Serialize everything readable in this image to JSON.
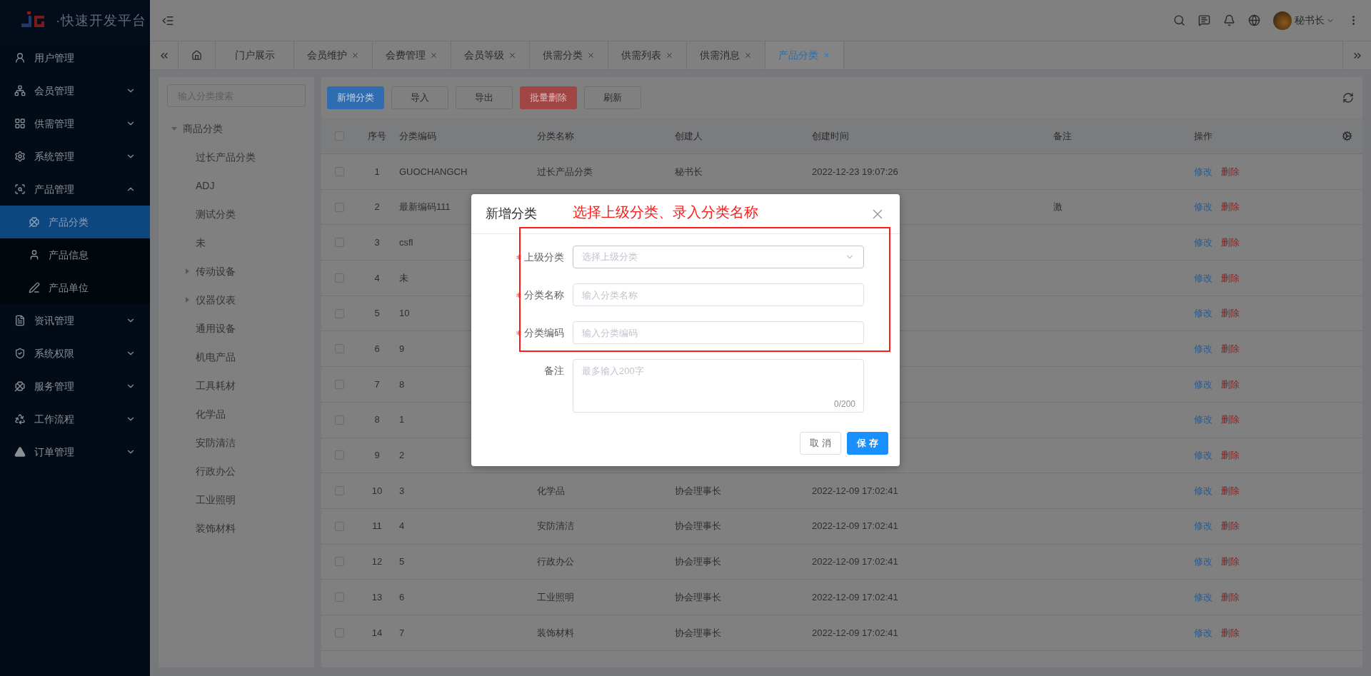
{
  "logo": {
    "text": "·快速开发平台"
  },
  "sidebar": {
    "items": [
      {
        "label": "用户管理",
        "kind": "link",
        "selected": false
      },
      {
        "label": "会员管理",
        "kind": "group",
        "expanded": false,
        "selected": false
      },
      {
        "label": "供需管理",
        "kind": "group",
        "expanded": false,
        "selected": false
      },
      {
        "label": "系统管理",
        "kind": "group",
        "expanded": false,
        "selected": false
      },
      {
        "label": "产品管理",
        "kind": "group",
        "expanded": true,
        "selected": false,
        "children": [
          {
            "label": "产品分类",
            "selected": true
          },
          {
            "label": "产品信息",
            "selected": false
          },
          {
            "label": "产品单位",
            "selected": false
          }
        ]
      },
      {
        "label": "资讯管理",
        "kind": "group",
        "expanded": false,
        "selected": false
      },
      {
        "label": "系统权限",
        "kind": "group",
        "expanded": false,
        "selected": false
      },
      {
        "label": "服务管理",
        "kind": "group",
        "expanded": false,
        "selected": false
      },
      {
        "label": "工作流程",
        "kind": "group",
        "expanded": false,
        "selected": false
      },
      {
        "label": "订单管理",
        "kind": "group",
        "expanded": false,
        "selected": false
      }
    ]
  },
  "header": {
    "user": {
      "name": "秘书长"
    }
  },
  "tabs": [
    {
      "kind": "home",
      "closable": false,
      "selected": false
    },
    {
      "label": "门户展示",
      "closable": false,
      "selected": false
    },
    {
      "label": "会员维护",
      "closable": true,
      "selected": false
    },
    {
      "label": "会费管理",
      "closable": true,
      "selected": false
    },
    {
      "label": "会员等级",
      "closable": true,
      "selected": false
    },
    {
      "label": "供需分类",
      "closable": true,
      "selected": false
    },
    {
      "label": "供需列表",
      "closable": true,
      "selected": false
    },
    {
      "label": "供需消息",
      "closable": true,
      "selected": false
    },
    {
      "label": "产品分类",
      "closable": true,
      "selected": true
    }
  ],
  "tree": {
    "search": {
      "placeholder": "输入分类搜索"
    },
    "root": {
      "label": "商品分类",
      "expanded": true,
      "children": [
        {
          "label": "过长产品分类"
        },
        {
          "label": "ADJ"
        },
        {
          "label": "测试分类"
        },
        {
          "label": "未"
        },
        {
          "label": "传动设备",
          "expanded": false
        },
        {
          "label": "仪器仪表",
          "expanded": false
        },
        {
          "label": "通用设备"
        },
        {
          "label": "机电产品"
        },
        {
          "label": "工具耗材"
        },
        {
          "label": "化学品"
        },
        {
          "label": "安防清洁"
        },
        {
          "label": "行政办公"
        },
        {
          "label": "工业照明"
        },
        {
          "label": "装饰材料"
        }
      ]
    }
  },
  "toolbar": {
    "buttons": [
      {
        "label": "新增分类",
        "kind": "primary"
      },
      {
        "label": "导入",
        "kind": "default"
      },
      {
        "label": "导出",
        "kind": "default"
      },
      {
        "label": "批量删除",
        "kind": "danger"
      },
      {
        "label": "刷新",
        "kind": "default"
      }
    ]
  },
  "table": {
    "header_checked": false,
    "columns": [
      "序号",
      "分类编码",
      "分类名称",
      "创建人",
      "创建时间",
      "备注",
      "操作"
    ],
    "rows": [
      {
        "checked": false,
        "index": "1",
        "code": "GUOCHANGCH",
        "name": "过长产品分类",
        "creator": "秘书长",
        "time": "2022-12-23 19:07:26",
        "actions": [
          "修改",
          "删除"
        ]
      },
      {
        "checked": false,
        "index": "2",
        "code": "最新编码111",
        "note": "激",
        "actions": [
          "修改",
          "删除"
        ]
      },
      {
        "checked": false,
        "index": "3",
        "code": "csfl",
        "actions": [
          "修改",
          "删除"
        ]
      },
      {
        "checked": false,
        "index": "4",
        "code": "未",
        "actions": [
          "修改",
          "删除"
        ]
      },
      {
        "checked": false,
        "index": "5",
        "code": "10",
        "actions": [
          "修改",
          "删除"
        ]
      },
      {
        "checked": false,
        "index": "6",
        "code": "9",
        "actions": [
          "修改",
          "删除"
        ]
      },
      {
        "checked": false,
        "index": "7",
        "code": "8",
        "actions": [
          "修改",
          "删除"
        ]
      },
      {
        "checked": false,
        "index": "8",
        "code": "1",
        "actions": [
          "修改",
          "删除"
        ]
      },
      {
        "checked": false,
        "index": "9",
        "code": "2",
        "actions": [
          "修改",
          "删除"
        ]
      },
      {
        "checked": false,
        "index": "10",
        "code": "3",
        "name": "化学品",
        "creator": "协会理事长",
        "time": "2022-12-09 17:02:41",
        "actions": [
          "修改",
          "删除"
        ]
      },
      {
        "checked": false,
        "index": "11",
        "code": "4",
        "name": "安防清洁",
        "creator": "协会理事长",
        "time": "2022-12-09 17:02:41",
        "actions": [
          "修改",
          "删除"
        ]
      },
      {
        "checked": false,
        "index": "12",
        "code": "5",
        "name": "行政办公",
        "creator": "协会理事长",
        "time": "2022-12-09 17:02:41",
        "actions": [
          "修改",
          "删除"
        ]
      },
      {
        "checked": false,
        "index": "13",
        "code": "6",
        "name": "工业照明",
        "creator": "协会理事长",
        "time": "2022-12-09 17:02:41",
        "actions": [
          "修改",
          "删除"
        ]
      },
      {
        "checked": false,
        "index": "14",
        "code": "7",
        "name": "装饰材料",
        "creator": "协会理事长",
        "time": "2022-12-09 17:02:41",
        "actions": [
          "修改",
          "删除"
        ]
      }
    ]
  },
  "dialog": {
    "title": "新增分类",
    "annotation": {
      "text": "选择上级分类、录入分类名称"
    },
    "fields": [
      {
        "label": "上级分类",
        "required": true,
        "kind": "select",
        "placeholder": "选择上级分类"
      },
      {
        "label": "分类名称",
        "required": true,
        "kind": "input",
        "placeholder": "输入分类名称"
      },
      {
        "label": "分类编码",
        "required": true,
        "kind": "input",
        "placeholder": "输入分类编码"
      },
      {
        "label": "备注",
        "required": false,
        "kind": "textarea",
        "placeholder": "最多输入200字",
        "counter": "0/200"
      }
    ],
    "buttons": [
      {
        "label": "取 消",
        "kind": "default"
      },
      {
        "label": "保 存",
        "kind": "primary"
      }
    ]
  }
}
